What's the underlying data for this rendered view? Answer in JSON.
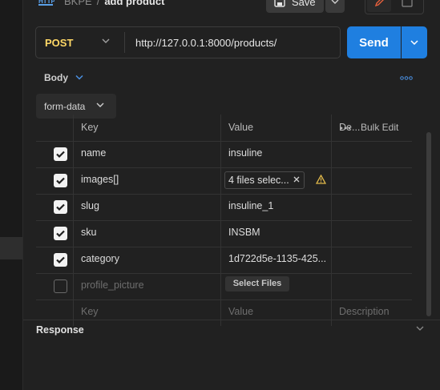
{
  "header": {
    "collection": "BKPE",
    "separator": "/",
    "request_name": "add product",
    "save_label": "Save"
  },
  "request": {
    "method": "POST",
    "url": "http://127.0.0.1:8000/products/",
    "send_label": "Send"
  },
  "body": {
    "tab_label": "Body",
    "mode": "form-data"
  },
  "table": {
    "headers": {
      "key": "Key",
      "value": "Value",
      "description": "De...",
      "bulk_edit": "Bulk Edit"
    },
    "rows": [
      {
        "checked": true,
        "key": "name",
        "value": "insuline"
      },
      {
        "checked": true,
        "key": "images[]",
        "value": "4 files selec..."
      },
      {
        "checked": true,
        "key": "slug",
        "value": "insuline_1"
      },
      {
        "checked": true,
        "key": "sku",
        "value": "INSBM"
      },
      {
        "checked": true,
        "key": "category",
        "value": "1d722d5e-1135-425..."
      },
      {
        "checked": false,
        "key": "profile_picture",
        "value": "Select Files"
      }
    ],
    "placeholder": {
      "key": "Key",
      "value": "Value",
      "description": "Description"
    }
  },
  "response": {
    "label": "Response"
  },
  "colors": {
    "accent": "#1f7fe0",
    "method": "#ffd866",
    "warning": "#e0b84a",
    "edit_icon": "#e8603c"
  }
}
